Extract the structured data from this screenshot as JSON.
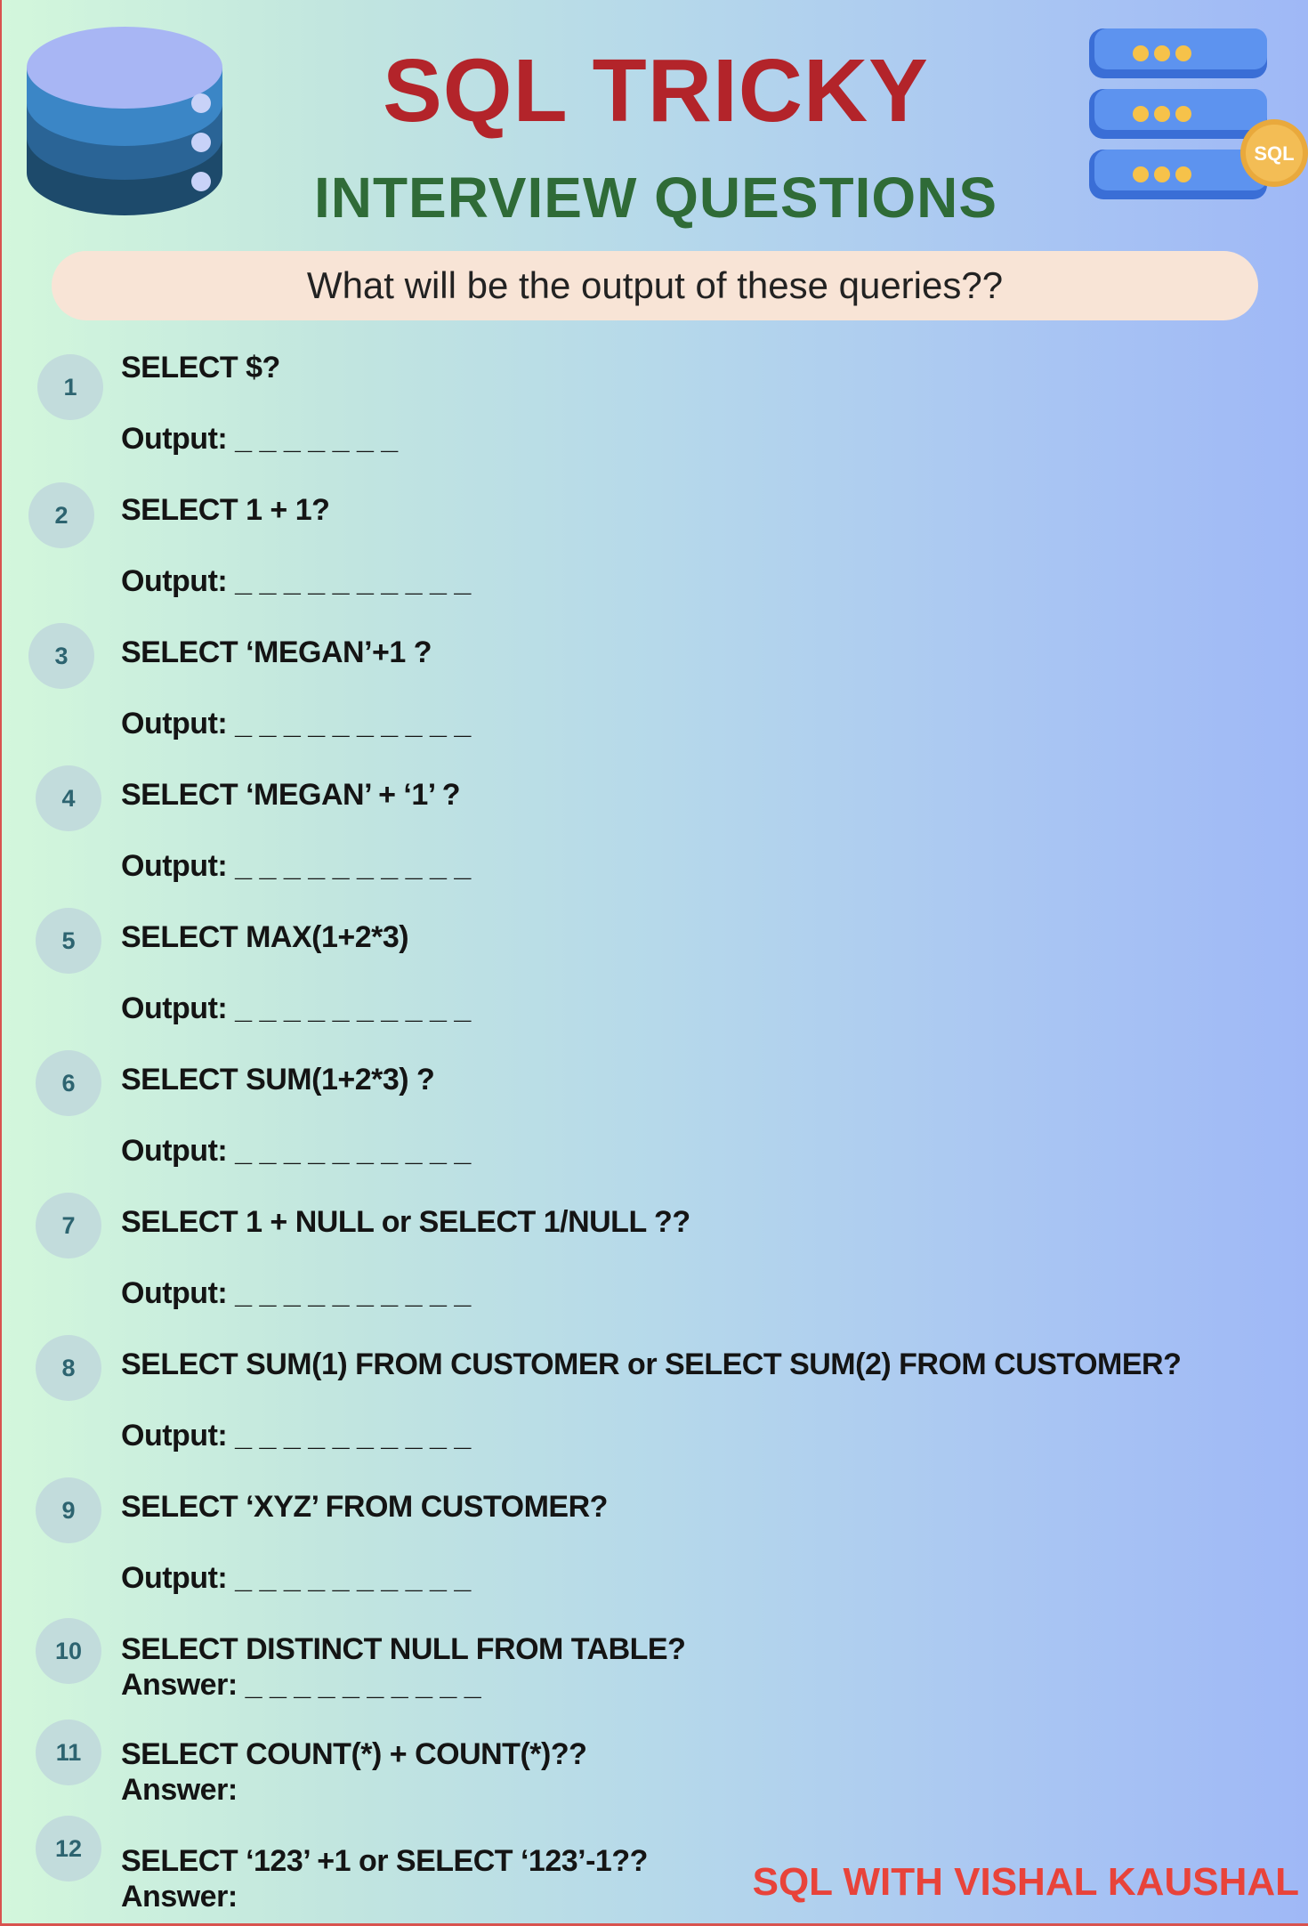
{
  "header": {
    "title": "SQL TRICKY",
    "subtitle": "INTERVIEW QUESTIONS",
    "prompt": "What will be the output of these queries??",
    "icons": {
      "left": "database-icon",
      "right": "sql-server-icon"
    },
    "server_badge": "SQL"
  },
  "questions": [
    {
      "num": "1",
      "query": "SELECT $?",
      "answer": "Output: _ _ _ _ _ _ _"
    },
    {
      "num": "2",
      "query": "SELECT 1 + 1?",
      "answer": "Output: _ _ _ _ _ _ _ _ _ _"
    },
    {
      "num": "3",
      "query": "SELECT ‘MEGAN’+1 ?",
      "answer": "Output: _ _ _ _ _ _ _ _ _ _"
    },
    {
      "num": "4",
      "query": "SELECT ‘MEGAN’ + ‘1’ ?",
      "answer": "Output: _ _ _ _ _ _ _ _ _ _"
    },
    {
      "num": "5",
      "query": "SELECT MAX(1+2*3)",
      "answer": "Output: _ _ _ _ _ _ _ _ _ _"
    },
    {
      "num": "6",
      "query": "SELECT  SUM(1+2*3)  ?",
      "answer": "Output: _ _ _ _ _ _ _ _ _ _"
    },
    {
      "num": "7",
      "query": "SELECT 1 + NULL  or SELECT 1/NULL ??",
      "answer": "Output: _ _ _ _ _ _ _ _ _ _"
    },
    {
      "num": "8",
      "query": "SELECT  SUM(1)  FROM CUSTOMER  or SELECT SUM(2)  FROM CUSTOMER?",
      "answer": "Output: _ _ _ _ _ _ _ _ _ _"
    },
    {
      "num": "9",
      "query": "SELECT  ‘XYZ’  FROM  CUSTOMER?",
      "answer": "Output: _ _ _ _ _ _ _ _ _ _"
    },
    {
      "num": "10",
      "query": "SELECT DISTINCT NULL FROM TABLE?",
      "answer": "Answer: _ _ _ _ _ _ _ _ _ _"
    },
    {
      "num": "11",
      "query": "SELECT COUNT(*) + COUNT(*)??",
      "answer": "Answer:"
    },
    {
      "num": "12",
      "query": "SELECT  ‘123’ +1   or SELECT  ‘123’-1??",
      "answer": "Answer:"
    }
  ],
  "footer": "SQL WITH VISHAL KAUSHAL",
  "colors": {
    "title": "#b3242a",
    "subtitle": "#2f6b37",
    "banner": "#f8e4d6",
    "number_circle": "#c2dcdc",
    "footer": "#e8433a"
  }
}
